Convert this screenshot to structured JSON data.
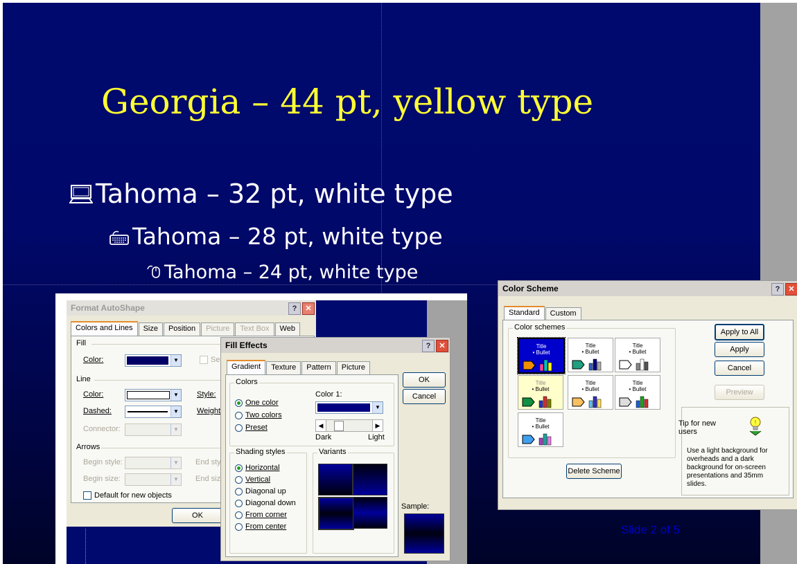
{
  "slide": {
    "title": "Georgia – 44 pt, yellow type",
    "bullets": [
      {
        "text": "Tahoma – 32 pt, white type",
        "icon": "computer-icon"
      },
      {
        "text": "Tahoma – 28 pt, white type",
        "icon": "keyboard-icon"
      },
      {
        "text": "Tahoma – 24 pt, white type",
        "icon": "mouse-icon"
      }
    ],
    "slide_number": "Slide 2 of 5"
  },
  "format_autoshape": {
    "title": "Format AutoShape",
    "tabs": [
      "Colors and Lines",
      "Size",
      "Position",
      "Picture",
      "Text Box",
      "Web"
    ],
    "fill_group": "Fill",
    "fill_color_label": "Color:",
    "fill_semitransparent": "Se",
    "line_group": "Line",
    "line_color_label": "Color:",
    "line_style_label": "Style:",
    "dashed_label": "Dashed:",
    "weight_label": "Weight:",
    "connector_label": "Connector:",
    "arrows_group": "Arrows",
    "begin_style_label": "Begin style:",
    "end_style_label": "End styl",
    "begin_size_label": "Begin size:",
    "end_size_label": "End size",
    "default_checkbox": "Default for new objects",
    "ok_button": "OK",
    "help_button": "?",
    "close_button": "✕",
    "colors": {
      "fill": "#000066",
      "line": "#ffffff"
    }
  },
  "fill_effects": {
    "title": "Fill Effects",
    "tabs": [
      "Gradient",
      "Texture",
      "Pattern",
      "Picture"
    ],
    "colors_group": "Colors",
    "radio_one": "One color",
    "radio_two": "Two colors",
    "radio_preset": "Preset",
    "color1_label": "Color 1:",
    "dark_label": "Dark",
    "light_label": "Light",
    "shading_group": "Shading styles",
    "shading": [
      "Horizontal",
      "Vertical",
      "Diagonal up",
      "Diagonal down",
      "From corner",
      "From center"
    ],
    "shading_selected": "Horizontal",
    "variants_group": "Variants",
    "sample_label": "Sample:",
    "ok_button": "OK",
    "cancel_button": "Cancel",
    "help_button": "?",
    "close_button": "✕",
    "colors": {
      "color1": "#000080"
    }
  },
  "color_scheme": {
    "title": "Color Scheme",
    "tabs": [
      "Standard",
      "Custom"
    ],
    "group_label": "Color schemes",
    "scheme_title": "Title",
    "scheme_bullet": "• Bullet",
    "apply_all_button": "Apply to All",
    "apply_button": "Apply",
    "cancel_button": "Cancel",
    "preview_button": "Preview",
    "delete_button": "Delete Scheme",
    "tip_title": "Tip for new users",
    "tip_text": "Use a light background for overheads and a dark background for on-screen presentations and 35mm slides.",
    "help_button": "?",
    "close_button": "✕",
    "colors": {
      "selected_bg": "#0000cc",
      "pale_yellow": "#ffffcc"
    }
  }
}
